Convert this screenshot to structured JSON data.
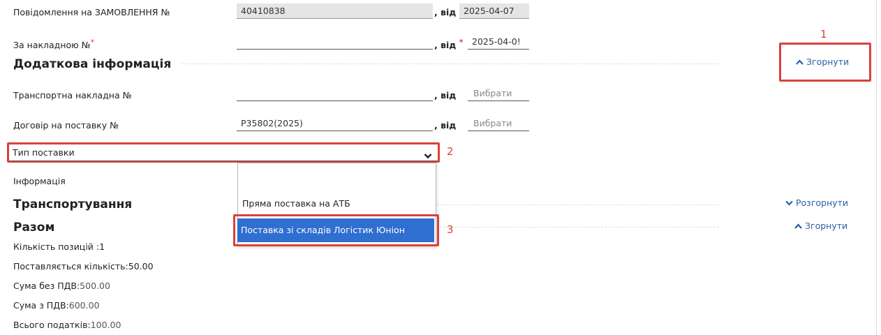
{
  "form": {
    "order_label": "Повідомлення на ЗАМОВЛЕННЯ №",
    "order_number": "40410838",
    "from_sep": ", від",
    "order_date": "2025-04-07",
    "invoice_label": "За накладною №",
    "required_mark": "*",
    "invoice_number": "",
    "invoice_date": "2025-04-0!"
  },
  "additional": {
    "title": "Додаткова інформація",
    "collapse_label": "Згорнути",
    "transport_label": "Транспортна накладна №",
    "transport_number": "",
    "choose_label": "Вибрати",
    "contract_label": "Договір на поставку №",
    "contract_number": "P35802(2025)",
    "delivery_type_label": "Тип поставки",
    "info_label": "Інформація"
  },
  "dropdown": {
    "options": [
      "",
      "Пряма поставка на АТБ",
      "Поставка зі складів Логістик Юніон"
    ],
    "selected_index": 2
  },
  "transport": {
    "title": "Транспортування",
    "expand_label": "Розгорнути"
  },
  "totals": {
    "title": "Разом",
    "collapse_label": "Згорнути",
    "positions": "Кількість позицій :1",
    "quantity": "Поставляється кількість:50.00",
    "sum_no_vat_label": "Сума без ПДВ:",
    "sum_no_vat": "500.00",
    "sum_vat_label": "Сума з ПДВ:",
    "sum_vat": "600.00",
    "taxes_label": "Всього податків:",
    "taxes": "100.00"
  },
  "annotations": {
    "n1": "1",
    "n2": "2",
    "n3": "3"
  },
  "colors": {
    "highlight_red": "#d9423a",
    "selected_blue": "#2f6fd0",
    "link_blue": "#2a5ea8"
  }
}
